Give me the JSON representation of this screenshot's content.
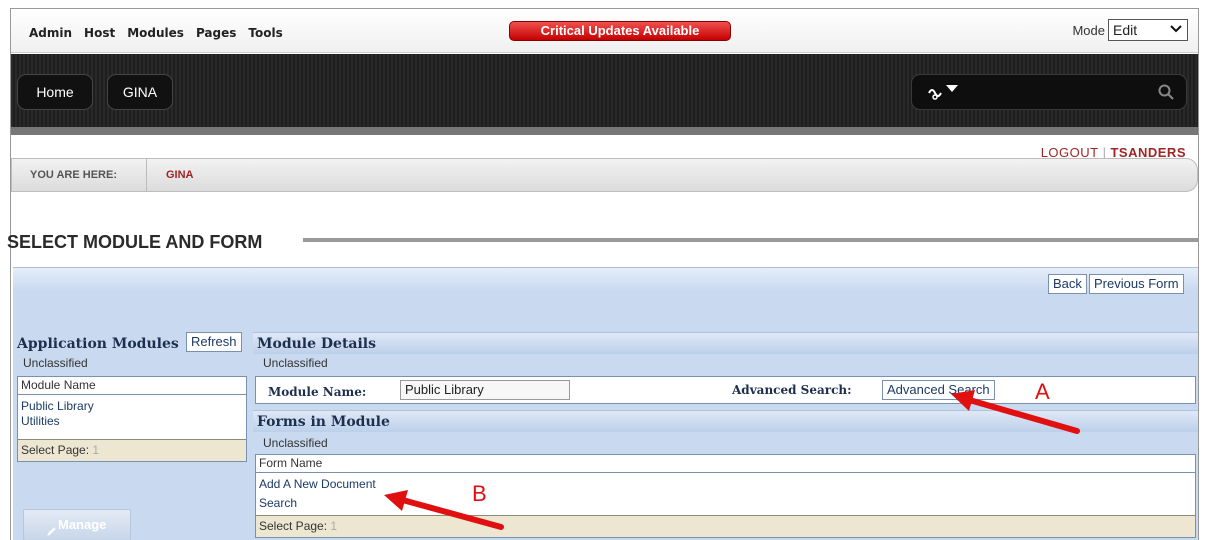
{
  "control_bar": {
    "menu": [
      "Admin",
      "Host",
      "Modules",
      "Pages",
      "Tools"
    ],
    "critical_label": "Critical Updates Available",
    "mode_label": "Mode",
    "mode_value": "Edit"
  },
  "nav": {
    "items": [
      "Home",
      "GINA"
    ]
  },
  "user": {
    "logout": "LOGOUT",
    "separator": "|",
    "username": "TSANDERS"
  },
  "breadcrumb": {
    "label": "YOU ARE HERE:",
    "current": "GINA"
  },
  "page": {
    "title": "SELECT MODULE AND FORM"
  },
  "toolbar": {
    "back": "Back",
    "previous_form": "Previous Form"
  },
  "modules": {
    "heading": "Application Modules",
    "refresh": "Refresh",
    "category": "Unclassified",
    "column": "Module Name",
    "items": [
      "Public Library",
      "Utilities"
    ],
    "select_page_label": "Select Page:",
    "select_page_value": "1"
  },
  "details": {
    "heading": "Module Details",
    "category": "Unclassified",
    "module_name_label": "Module Name:",
    "module_name_value": "Public Library",
    "advanced_search_label": "Advanced Search:",
    "advanced_search_button": "Advanced Search"
  },
  "forms": {
    "heading": "Forms in Module",
    "category": "Unclassified",
    "column": "Form Name",
    "items": [
      "Add A New Document",
      "Search"
    ],
    "select_page_label": "Select Page:",
    "select_page_value": "1"
  },
  "manage": {
    "label": "Manage"
  },
  "annotations": {
    "a": "A",
    "b": "B",
    "arrow_color": "#e01010"
  }
}
